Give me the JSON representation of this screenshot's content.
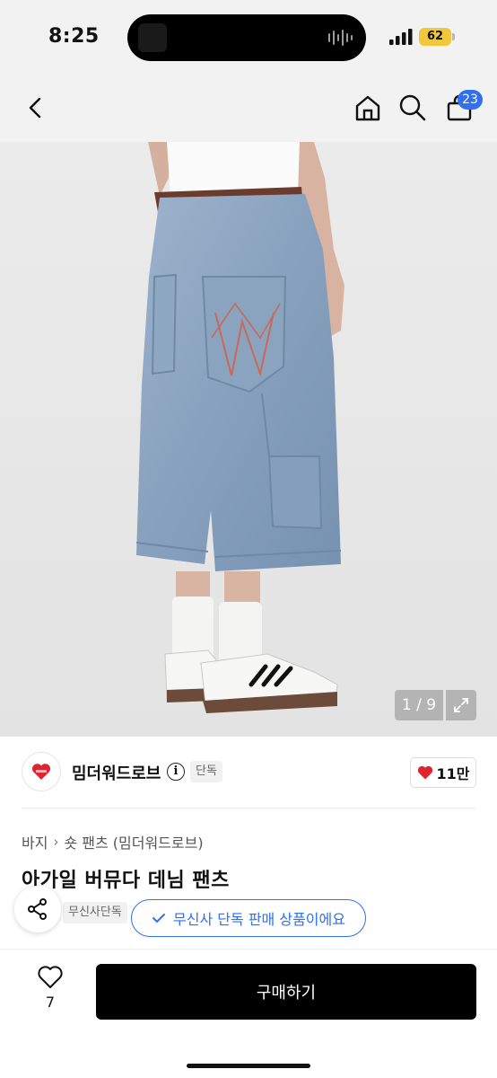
{
  "status_bar": {
    "time": "8:25",
    "battery": "62"
  },
  "nav": {
    "cart_count": "23",
    "icons": [
      "back-icon",
      "home-icon",
      "search-icon",
      "bag-icon"
    ]
  },
  "gallery": {
    "counter": "1 / 9"
  },
  "brand": {
    "name": "밈더워드로브",
    "tag": "단독",
    "likes": "11만",
    "like_color": "#e0232f"
  },
  "breadcrumb": {
    "category": "바지",
    "subcategory": "숏 팬츠 (밈더워드로브)"
  },
  "product": {
    "title": "아가일 버뮤다 데님 팬츠",
    "exclusive_tag": "무신사단독",
    "exclusive_note": "무신사 단독 판매 상품이에요"
  },
  "bottom": {
    "wish_count": "7",
    "buy_label": "구매하기"
  },
  "colors": {
    "accent": "#2f6ff0",
    "buy_button": "#000000",
    "battery": "#f1c83b"
  }
}
